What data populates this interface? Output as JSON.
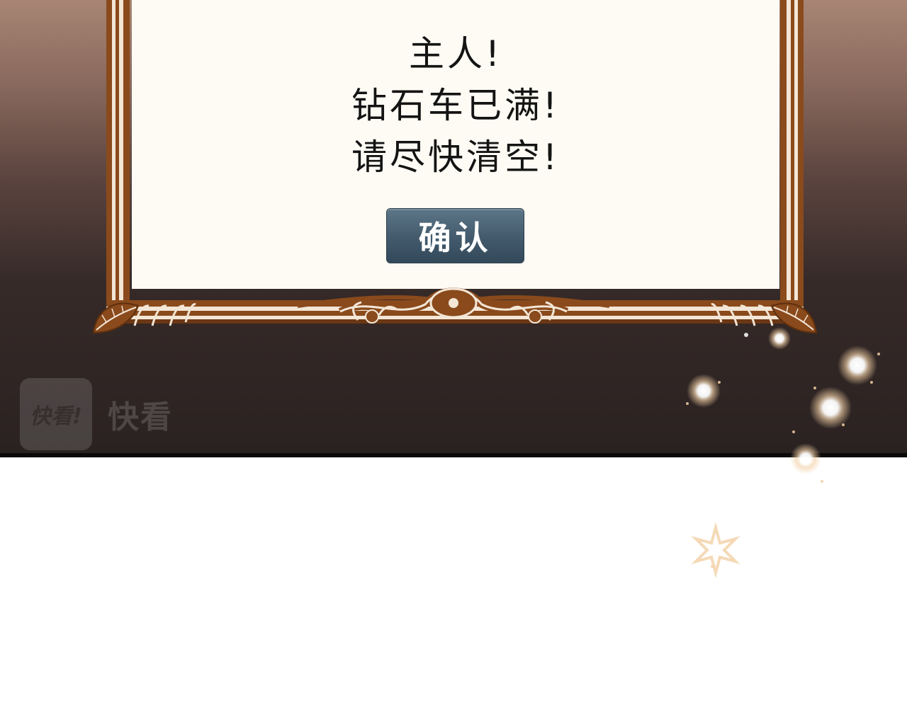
{
  "dialog": {
    "message_lines": [
      "主人!",
      "钻石车已满!",
      "请尽快清空!"
    ],
    "confirm_label": "确认"
  },
  "watermark": {
    "logo_text": "快看!",
    "brand_text": "快看"
  },
  "colors": {
    "frame_brown": "#8a4a1c",
    "frame_dark": "#5e2f0e",
    "paper": "#fdfbf4",
    "button": "#46606f",
    "sparkle": "#f6d7b2"
  }
}
